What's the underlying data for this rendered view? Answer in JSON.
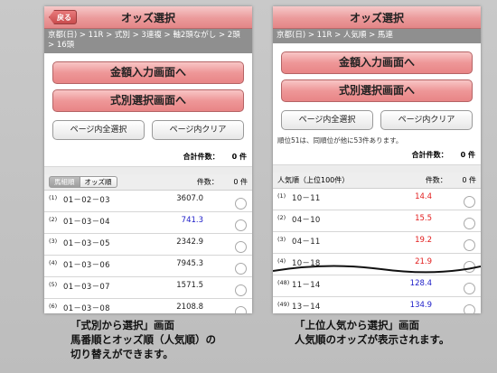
{
  "left": {
    "back_label": "戻る",
    "title": "オッズ選択",
    "breadcrumb": "京都(日) > 11R > 式別 > 3連複 > 軸2頭ながし > 2頭 > 16頭",
    "btn_amount": "金額入力画面へ",
    "btn_type": "式別選択画面へ",
    "btn_select_all": "ページ内全選択",
    "btn_clear": "ページ内クリア",
    "total_label": "合計件数：",
    "total_value": "0 件",
    "tab_horse": "馬組順",
    "tab_odds": "オッズ順",
    "count_label": "件数：",
    "count_value": "0 件",
    "rows": [
      {
        "rank": "(1)",
        "combo": "01－02－03",
        "odds": "3607.0",
        "color": "#222222"
      },
      {
        "rank": "(2)",
        "combo": "01－03－04",
        "odds": "741.3",
        "color": "#1c1cc8"
      },
      {
        "rank": "(3)",
        "combo": "01－03－05",
        "odds": "2342.9",
        "color": "#222222"
      },
      {
        "rank": "(4)",
        "combo": "01－03－06",
        "odds": "7945.3",
        "color": "#222222"
      },
      {
        "rank": "(5)",
        "combo": "01－03－07",
        "odds": "1571.5",
        "color": "#222222"
      },
      {
        "rank": "(6)",
        "combo": "01－03－08",
        "odds": "2108.8",
        "color": "#222222"
      }
    ],
    "caption": [
      "「式別から選択」画面",
      "馬番順とオッズ順（人気順）の",
      "切り替えができます。"
    ]
  },
  "right": {
    "title": "オッズ選択",
    "breadcrumb": "京都(日) > 11R > 人気順 > 馬連",
    "btn_amount": "金額入力画面へ",
    "btn_type": "式別選択画面へ",
    "btn_select_all": "ページ内全選択",
    "btn_clear": "ページ内クリア",
    "note": "順位51は、同順位が他に53件あります。",
    "total_label": "合計件数：",
    "total_value": "0 件",
    "list_title": "人気順（上位100件）",
    "count_label": "件数：",
    "count_value": "0 件",
    "rows": [
      {
        "rank": "(1)",
        "combo": "10－11",
        "odds": "14.4",
        "color": "#e21c1c"
      },
      {
        "rank": "(2)",
        "combo": "04－10",
        "odds": "15.5",
        "color": "#e21c1c"
      },
      {
        "rank": "(3)",
        "combo": "04－11",
        "odds": "19.2",
        "color": "#e21c1c"
      },
      {
        "rank": "(4)",
        "combo": "10－18",
        "odds": "21.9",
        "color": "#e21c1c"
      },
      {
        "rank": "(48)",
        "combo": "11－14",
        "odds": "128.4",
        "color": "#1c1cc8"
      },
      {
        "rank": "(49)",
        "combo": "13－14",
        "odds": "134.9",
        "color": "#1c1cc8"
      }
    ],
    "caption": [
      "「上位人気から選択」画面",
      "人気順のオッズが表示されます。"
    ]
  }
}
